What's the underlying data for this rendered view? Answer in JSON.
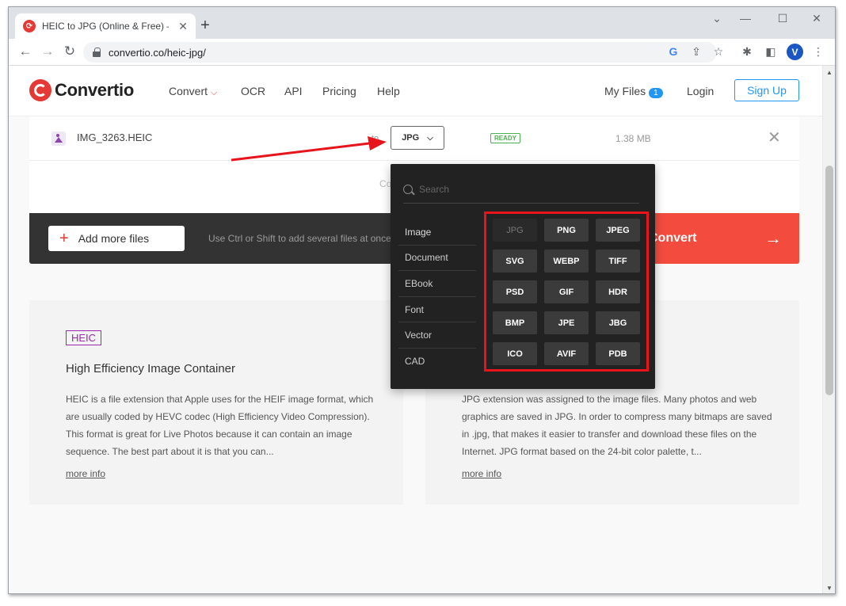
{
  "browser": {
    "tab_title": "HEIC to JPG (Online & Free) — C",
    "url": "convertio.co/heic-jpg/",
    "avatar_letter": "V"
  },
  "site": {
    "logo_text": "Convertio",
    "nav": {
      "convert": "Convert",
      "ocr": "OCR",
      "api": "API",
      "pricing": "Pricing",
      "help": "Help"
    },
    "my_files": "My Files",
    "my_files_count": "1",
    "login": "Login",
    "signup": "Sign Up"
  },
  "file": {
    "name": "IMG_3263.HEIC",
    "to_label": "to",
    "target_format": "JPG",
    "status": "READY",
    "size": "1.38 MB"
  },
  "convert_all_label": "Co",
  "actions": {
    "add_files": "Add more files",
    "hint": "Use Ctrl or Shift to add several files at once",
    "convert": "Convert"
  },
  "dropdown": {
    "search_placeholder": "Search",
    "categories": [
      "Image",
      "Document",
      "EBook",
      "Font",
      "Vector",
      "CAD"
    ],
    "formats": [
      "JPG",
      "PNG",
      "JPEG",
      "SVG",
      "WEBP",
      "TIFF",
      "PSD",
      "GIF",
      "HDR",
      "BMP",
      "JPE",
      "JBG",
      "ICO",
      "AVIF",
      "PDB"
    ]
  },
  "cards": {
    "left": {
      "tag": "HEIC",
      "title": "High Efficiency Image Container",
      "desc": "HEIC is a file extension that Apple uses for the HEIF image format, which are usually coded by HEVC codec (High Efficiency Video Compression). This format is great for Live Photos because it can contain an image sequence. The best part about it is that you can...",
      "more": "more info"
    },
    "right": {
      "desc": "JPG extension was assigned to the image files. Many photos and web graphics are saved in JPG. In order to compress many bitmaps are saved in .jpg, that makes it easier to transfer and download these files on the Internet. JPG format based on the 24-bit color palette, t...",
      "more": "more info"
    }
  },
  "colors": {
    "brand_red": "#e53935",
    "accent_blue": "#2196f3",
    "annotation_red": "#e8141b"
  }
}
